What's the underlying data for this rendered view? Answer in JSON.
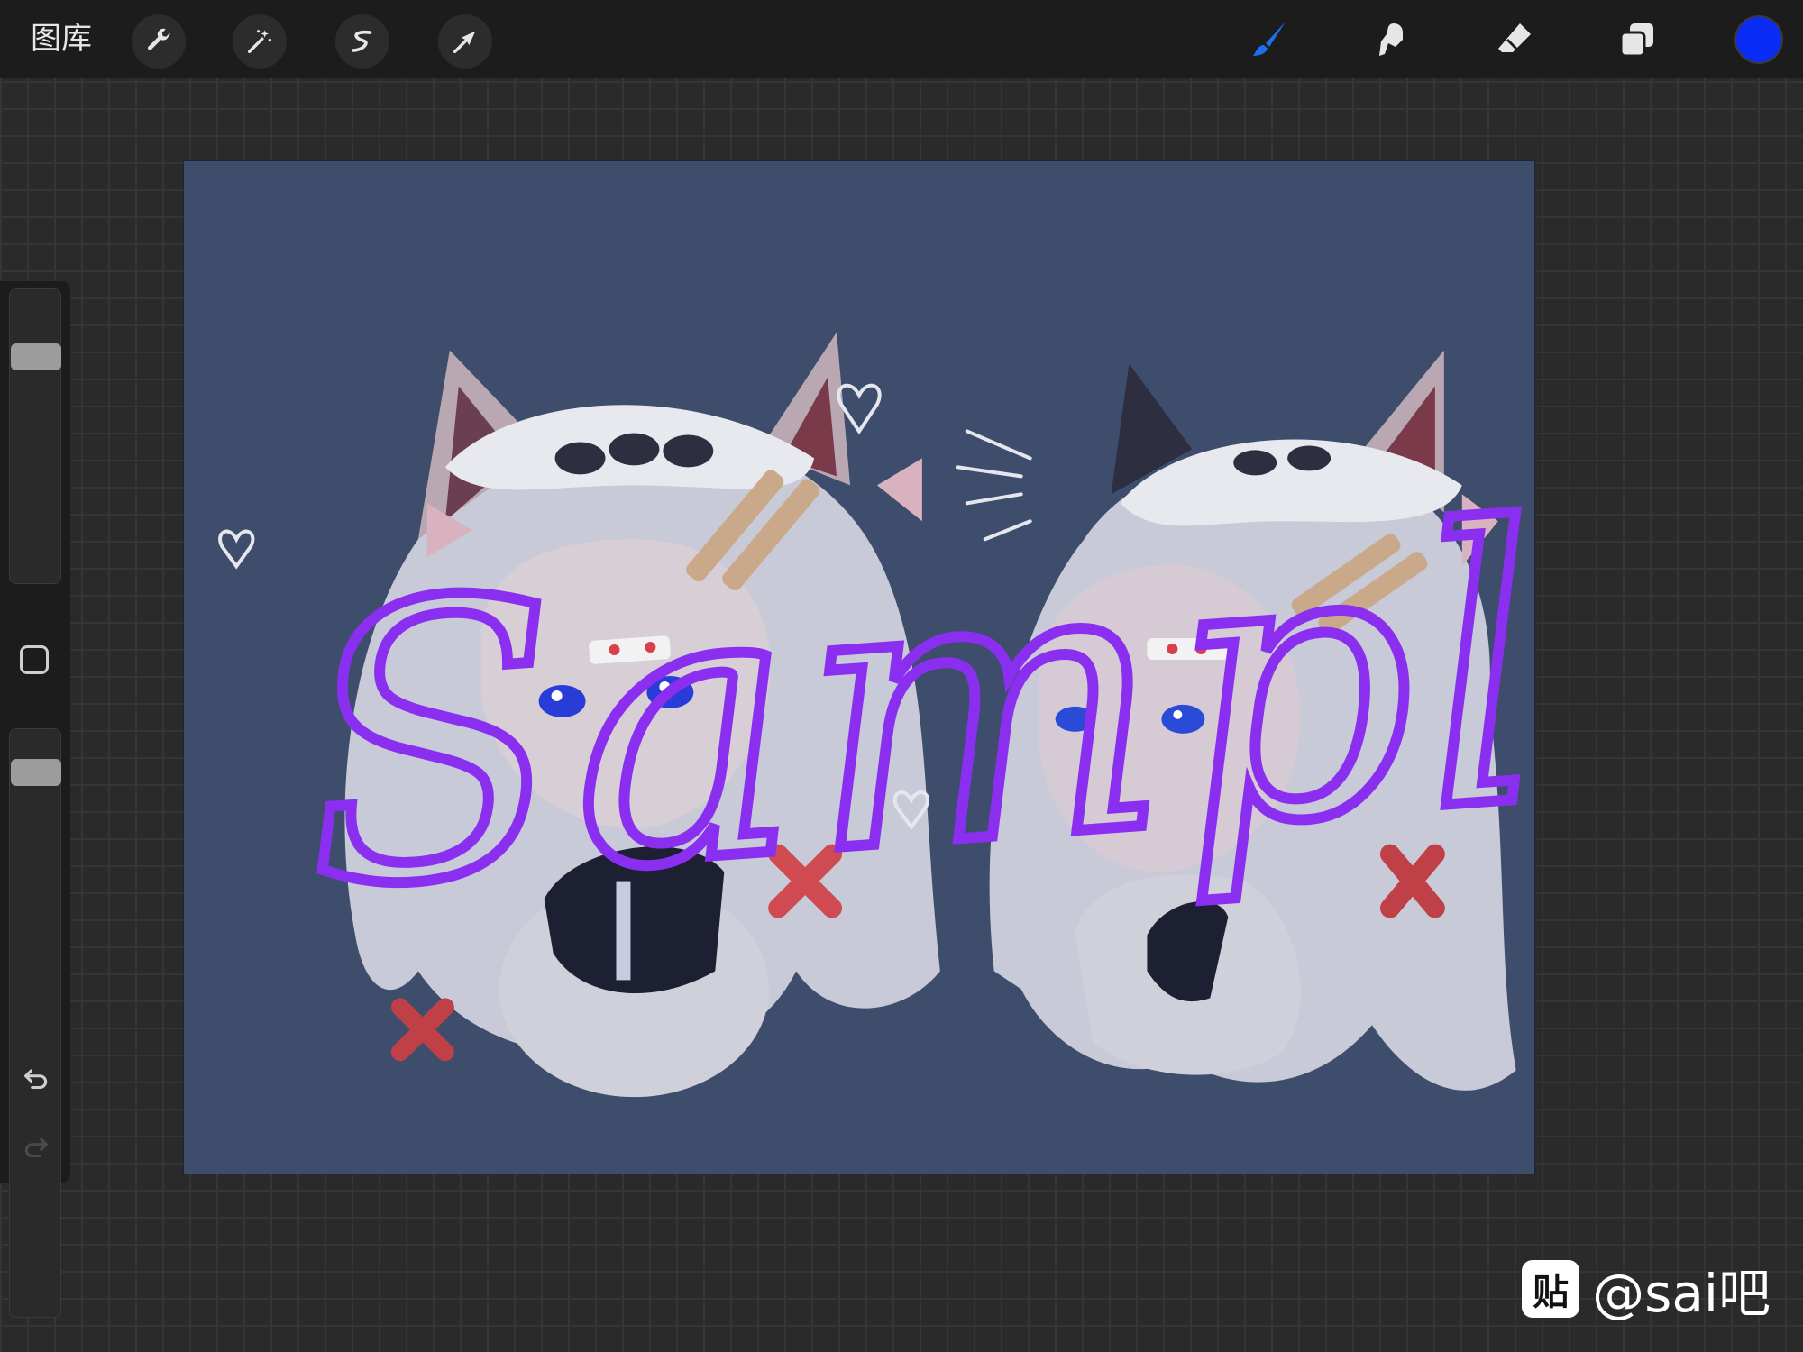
{
  "topbar": {
    "gallery_label": "图库",
    "left_tools": [
      "wrench-icon",
      "magic-wand-icon",
      "selection-icon",
      "transform-arrow-icon"
    ],
    "right_tools": [
      "brush-icon",
      "smudge-icon",
      "eraser-icon",
      "layers-icon"
    ],
    "current_color": "#0a2cf5",
    "active_tool_color": "#1e6ff0"
  },
  "sidebar": {
    "brush_size": 0.8,
    "opacity": 0.95,
    "undo_label": "undo",
    "redo_label": "redo"
  },
  "canvas": {
    "background_color": "#3d4d6b",
    "overlay_text": "Sample",
    "overlay_color": "#8a2ff0"
  },
  "watermark": {
    "logo_char": "贴",
    "text": "@sai吧"
  }
}
